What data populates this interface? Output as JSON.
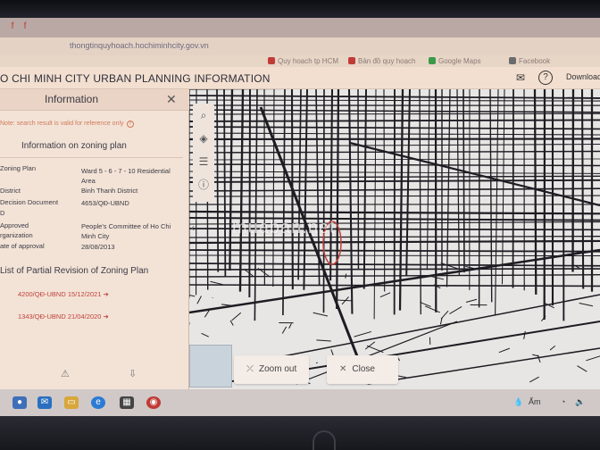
{
  "browser": {
    "url": "thongtinquyhoach.hochiminhcity.gov.vn",
    "bookmarks": [
      "Quy hoạch tp HCM",
      "Bản đồ quy hoạch",
      "Google Maps",
      "Facebook"
    ]
  },
  "header": {
    "title": "O CHI MINH CITY URBAN PLANNING INFORMATION",
    "download_label": "Download A"
  },
  "panel": {
    "title": "Information",
    "note": "Note: search result is valid for reference only",
    "subtitle": "Information on zoning plan",
    "rows": [
      {
        "label": "Zoning Plan",
        "value": "Ward 5 - 6 - 7 - 10 Residential Area"
      },
      {
        "label": "District",
        "value": "Binh Thanh District"
      },
      {
        "label": "Decision Document",
        "value": "4653/QĐ-UBND"
      },
      {
        "label": "D",
        "value": ""
      },
      {
        "label": "Approved",
        "value": "People's Committee of Ho Chi Minh City"
      },
      {
        "label": "rganization",
        "value": ""
      },
      {
        "label": "ate of approval",
        "value": "28/08/2013"
      }
    ],
    "revision_title": "List of Partial Revision of Zoning Plan",
    "revisions": [
      "4200/QĐ-UBND 15/12/2021",
      "1343/QĐ-UBND 21/04/2020"
    ]
  },
  "map": {
    "watermark": "muabán",
    "watermark_suffix": ".net",
    "zoom_out_label": "Zoom out",
    "close_label": "Close"
  },
  "taskbar": {
    "weather": "Ấm"
  },
  "icons": {
    "mail": "mail-icon",
    "help": "help-icon",
    "search": "search-icon",
    "layers": "layers-icon",
    "list": "list-icon",
    "info": "info-icon"
  },
  "colors": {
    "panel_bg": "#f3e3d6",
    "link_red": "#c0413c",
    "note_orange": "#d07a5c"
  }
}
